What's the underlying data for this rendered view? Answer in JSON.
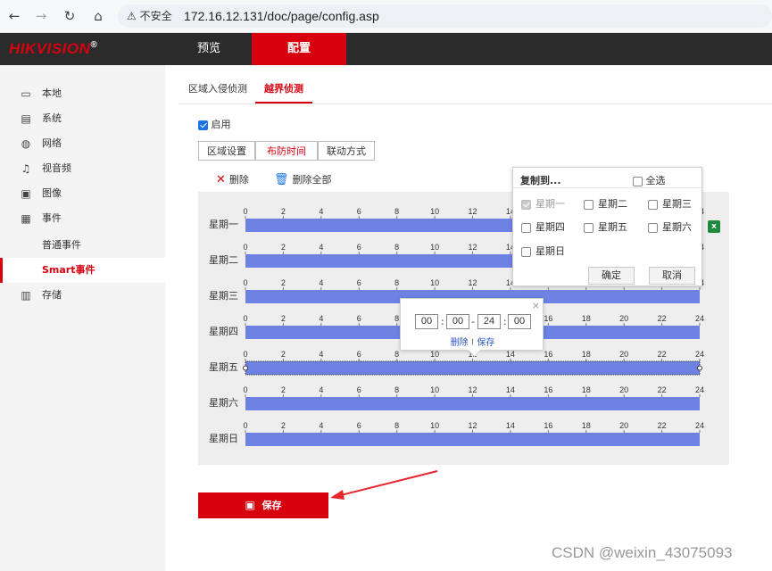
{
  "browser": {
    "secure_label": "不安全",
    "url": "172.16.12.131/doc/page/config.asp",
    "icons": [
      "back-arrow-icon",
      "forward-arrow-icon",
      "reload-icon",
      "home-icon",
      "warning-icon"
    ]
  },
  "header": {
    "brand": "HIKVISION",
    "brand_mark": "®",
    "tabs": [
      "预览",
      "配置"
    ],
    "active_tab": "配置",
    "accent": "#d7000f",
    "bar_color": "#2b2b2b"
  },
  "sidebar": {
    "items": [
      {
        "label": "本地",
        "icon": "monitor-icon"
      },
      {
        "label": "系统",
        "icon": "system-icon"
      },
      {
        "label": "网络",
        "icon": "globe-icon"
      },
      {
        "label": "视音频",
        "icon": "audio-video-icon"
      },
      {
        "label": "图像",
        "icon": "image-icon"
      },
      {
        "label": "事件",
        "icon": "calendar-icon"
      }
    ],
    "sub_items": [
      {
        "label": "普通事件"
      },
      {
        "label": "Smart事件",
        "active": true
      }
    ],
    "last_item": {
      "label": "存储",
      "icon": "storage-icon"
    }
  },
  "tabs": {
    "items": [
      "区域入侵侦测",
      "越界侦测"
    ],
    "active": "越界侦测"
  },
  "enable": {
    "label": "启用",
    "checked": true
  },
  "steps": [
    "区域设置",
    "布防时间",
    "联动方式"
  ],
  "active_step": "布防时间",
  "toolbar": {
    "delete": "删除",
    "delete_all": "删除全部"
  },
  "schedule": {
    "days": [
      "星期一",
      "星期二",
      "星期三",
      "星期四",
      "星期五",
      "星期六",
      "星期日"
    ],
    "hour_ticks": [
      "0",
      "2",
      "4",
      "6",
      "8",
      "10",
      "12",
      "14",
      "16",
      "18",
      "20",
      "22",
      "24"
    ],
    "bar_color": "#6d82e3",
    "selected_day": "星期五",
    "segments": [
      {
        "day": "星期一",
        "start": 0,
        "end": 24
      },
      {
        "day": "星期二",
        "start": 0,
        "end": 24
      },
      {
        "day": "星期三",
        "start": 0,
        "end": 24
      },
      {
        "day": "星期四",
        "start": 0,
        "end": 24
      },
      {
        "day": "星期五",
        "start": 0,
        "end": 24
      },
      {
        "day": "星期六",
        "start": 0,
        "end": 24
      },
      {
        "day": "星期日",
        "start": 0,
        "end": 24
      }
    ]
  },
  "copy_popup": {
    "title": "复制到...",
    "select_all": "全选",
    "options": [
      {
        "label": "星期一",
        "checked": true,
        "disabled": true
      },
      {
        "label": "星期二",
        "checked": false
      },
      {
        "label": "星期三",
        "checked": false
      },
      {
        "label": "星期四",
        "checked": false
      },
      {
        "label": "星期五",
        "checked": false
      },
      {
        "label": "星期六",
        "checked": false
      },
      {
        "label": "星期日",
        "checked": false
      }
    ],
    "ok": "确定",
    "cancel": "取消"
  },
  "time_popup": {
    "start_h": "00",
    "start_m": "00",
    "end_h": "24",
    "end_m": "00",
    "colon": ":",
    "dash": "-",
    "delete": "删除",
    "sep": "|",
    "save": "保存",
    "close": "×"
  },
  "save_button": "保存",
  "watermark": "CSDN @weixin_43075093"
}
